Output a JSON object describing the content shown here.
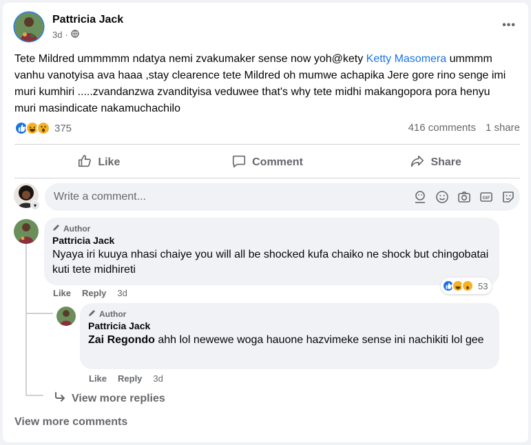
{
  "post": {
    "author": "Pattricia Jack",
    "time": "3d",
    "privacy_icon": "globe-icon",
    "text_part1": "Tete Mildred ummmmm ndatya nemi zvakumaker sense now yoh@kety ",
    "mention": "Ketty Masomera",
    "text_part2": " ummmm vanhu vanotyisa ava haaa ,stay clearence tete Mildred oh mumwe achapika Jere gore rino senge imi muri kumhiri .....zvandanzwa zvandityisa veduwee that's why tete midhi makangopora pora henyu muri masindicate nakamuchachilo",
    "reaction_count": "375",
    "comments_count": "416 comments",
    "shares_count": "1 share"
  },
  "actions": {
    "like": "Like",
    "comment": "Comment",
    "share": "Share"
  },
  "composer": {
    "placeholder": "Write a comment..."
  },
  "comments": [
    {
      "badge": "Author",
      "name": "Pattricia Jack",
      "text": "Nyaya iri kuuya nhasi chaiye you will all be shocked kufa chaiko ne shock but chingobatai kuti tete midhireti",
      "like": "Like",
      "reply": "Reply",
      "time": "3d",
      "reaction_count": "53",
      "reply_item": {
        "badge": "Author",
        "name": "Pattricia Jack",
        "mention": "Zai Regondo",
        "text": " ahh lol newewe woga hauone hazvimeke sense ini nachikiti lol gee",
        "like": "Like",
        "reply": "Reply",
        "time": "3d"
      }
    }
  ],
  "view_more_replies": "View more replies",
  "view_more_comments": "View more comments",
  "colors": {
    "accent": "#1b74e4",
    "like": "#1b74e4",
    "haha": "#f7b125",
    "muted": "#65676b",
    "bubble": "#f0f2f5"
  }
}
